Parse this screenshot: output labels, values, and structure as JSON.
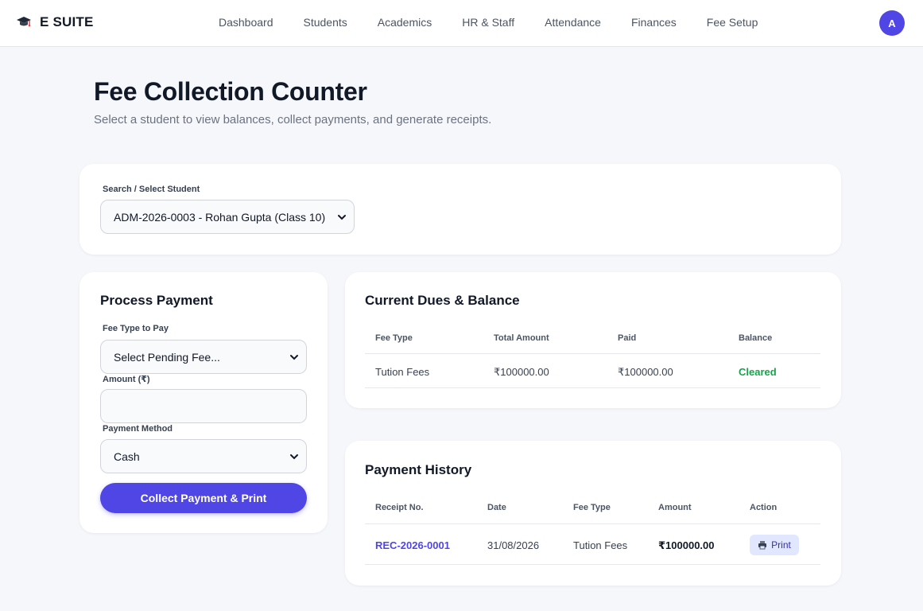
{
  "app": {
    "brand": "E SUITE",
    "brand_icon": "graduation-cap-icon",
    "avatar_initial": "A",
    "accent_color": "#4f46e5"
  },
  "nav": {
    "items": [
      "Dashboard",
      "Students",
      "Academics",
      "HR & Staff",
      "Attendance",
      "Finances",
      "Fee Setup"
    ]
  },
  "header": {
    "title": "Fee Collection Counter",
    "subtitle": "Select a student to view balances, collect payments, and generate receipts."
  },
  "student_search": {
    "label": "Search / Select Student",
    "selected": "ADM-2026-0003 - Rohan Gupta (Class 10)"
  },
  "payment_form": {
    "title": "Process Payment",
    "fee_type_label": "Fee Type to Pay",
    "fee_type_selected": "Select Pending Fee...",
    "amount_label": "Amount (₹)",
    "amount_value": "",
    "method_label": "Payment Method",
    "method_selected": "Cash",
    "submit_label": "Collect Payment & Print"
  },
  "dues": {
    "title": "Current Dues & Balance",
    "columns": [
      "Fee Type",
      "Total Amount",
      "Paid",
      "Balance"
    ],
    "rows": [
      {
        "fee_type": "Tution Fees",
        "total": "₹100000.00",
        "paid": "₹100000.00",
        "balance": "Cleared",
        "balance_color": "#16a34a"
      }
    ]
  },
  "history": {
    "title": "Payment History",
    "columns": [
      "Receipt No.",
      "Date",
      "Fee Type",
      "Amount",
      "Action"
    ],
    "rows": [
      {
        "receipt": "REC-2026-0001",
        "date": "31/08/2026",
        "fee_type": "Tution Fees",
        "amount": "₹100000.00",
        "action": "Print",
        "action_icon": "printer-icon"
      }
    ]
  }
}
